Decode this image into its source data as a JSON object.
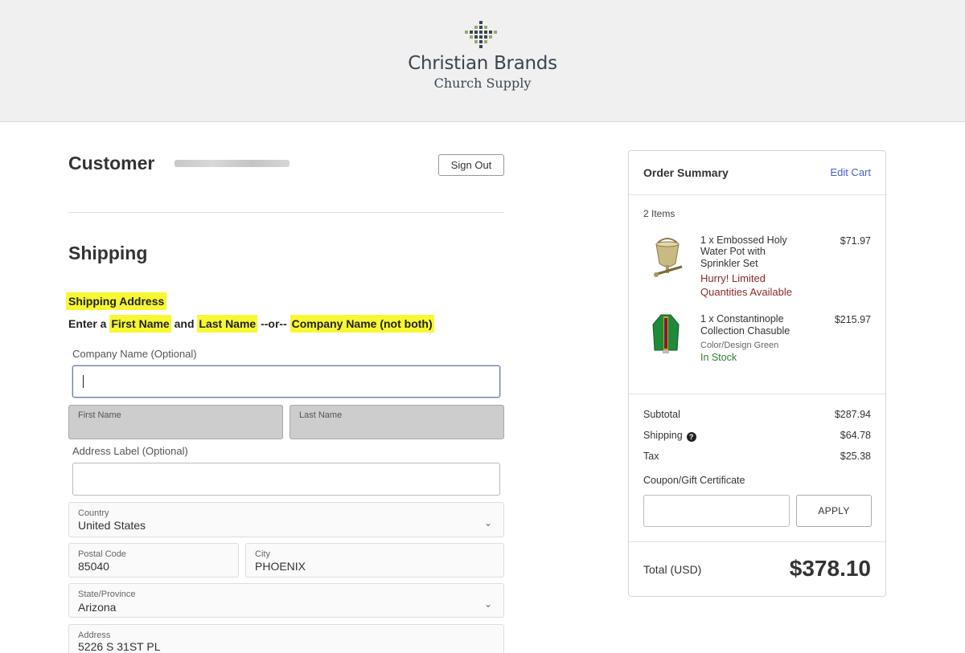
{
  "header": {
    "brand_name": "Christian Brands",
    "brand_sub": "Church Supply"
  },
  "customer": {
    "title": "Customer",
    "sign_out_label": "Sign Out"
  },
  "shipping": {
    "title": "Shipping",
    "address_heading": "Shipping Address",
    "instruction": {
      "part1": "Enter a ",
      "first_name": "First Name",
      "part2": " and ",
      "last_name": "Last Name",
      "part3": " --or-- ",
      "company": "Company Name (not both)"
    },
    "company_label": "Company Name (Optional)",
    "company_value": "",
    "first_name_label": "First Name",
    "last_name_label": "Last Name",
    "address_label_label": "Address Label (Optional)",
    "address_label_value": "",
    "country_label": "Country",
    "country_value": "United States",
    "postal_label": "Postal Code",
    "postal_value": "85040",
    "city_label": "City",
    "city_value": "PHOENIX",
    "state_label": "State/Province",
    "state_value": "Arizona",
    "address_field_label": "Address",
    "address_value": "5226 S 31ST PL"
  },
  "summary": {
    "title": "Order Summary",
    "edit_cart": "Edit Cart",
    "items_count": "2 Items",
    "items": [
      {
        "name_line1": "1 x Embossed Holy",
        "name_line2": "Water Pot with",
        "name_line3": "Sprinkler Set",
        "price": "$71.97",
        "warning_line1": "Hurry! Limited",
        "warning_line2": "Quantities Available"
      },
      {
        "name_line1": "1 x Constantinople",
        "name_line2": "Collection Chasuble",
        "price": "$215.97",
        "option": "Color/Design Green",
        "stock": "In Stock"
      }
    ],
    "subtotal_label": "Subtotal",
    "subtotal_value": "$287.94",
    "shipping_label": "Shipping",
    "shipping_value": "$64.78",
    "tax_label": "Tax",
    "tax_value": "$25.38",
    "coupon_label": "Coupon/Gift Certificate",
    "apply_label": "APPLY",
    "total_label": "Total (USD)",
    "total_value": "$378.10"
  },
  "colors": {
    "highlight": "#f7f733",
    "link": "#4a5fc1",
    "warning": "#8b2a2a",
    "in_stock": "#2e7d32"
  }
}
